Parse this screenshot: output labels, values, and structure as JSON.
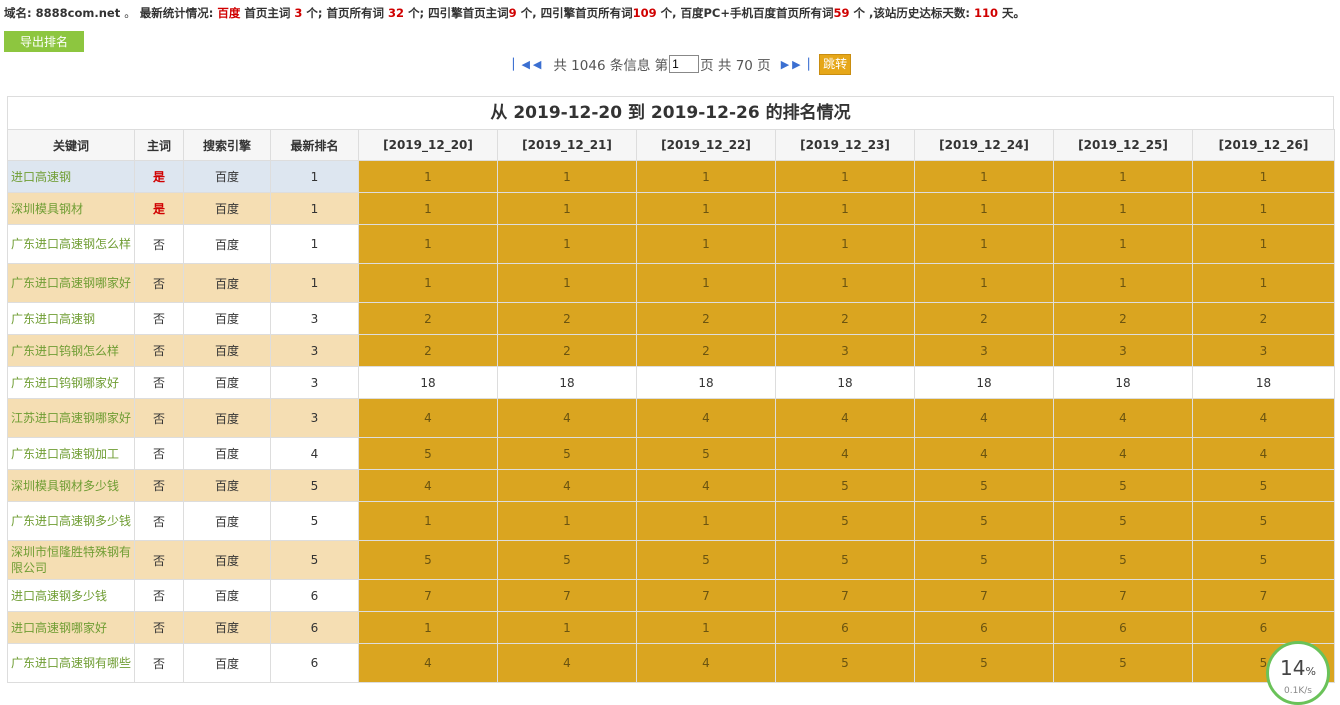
{
  "stats": {
    "label_domain": "域名:",
    "domain": "8888com.net",
    "sep1": "。",
    "label_latest": "最新统计情况:",
    "engine": "百度",
    "label_home_main": "首页主词",
    "home_main": "3",
    "unit1": "个; 首页所有词",
    "home_all": "32",
    "unit2": "个; 四引擎首页主词",
    "four_main": "9",
    "unit3": "个, 四引擎首页所有词",
    "four_all": "109",
    "unit4": "个, 百度PC+手机百度首页所有词",
    "pc_mobile": "59",
    "unit5": "个 ,该站历史达标天数:",
    "days": "110",
    "unit6": "天。"
  },
  "toolbar": {
    "export_label": "导出排名"
  },
  "pager": {
    "first_icon": "first-page-icon",
    "prev_icon": "prev-page-icon",
    "next_icon": "next-page-icon",
    "last_icon": "last-page-icon",
    "total_text": "共 1046 条信息 第",
    "page_value": "1",
    "pages_text": "页 共 70 页",
    "go_label": "跳转"
  },
  "table": {
    "caption": "从 2019-12-20 到 2019-12-26 的排名情况",
    "headers": [
      "关键词",
      "主词",
      "搜索引擎",
      "最新排名",
      "[2019_12_20]",
      "[2019_12_21]",
      "[2019_12_22]",
      "[2019_12_23]",
      "[2019_12_24]",
      "[2019_12_25]",
      "[2019_12_26]"
    ],
    "rows": [
      {
        "keyword": "进口高速钢",
        "main": "是",
        "engine": "百度",
        "latest": "1",
        "days": [
          "1",
          "1",
          "1",
          "1",
          "1",
          "1",
          "1"
        ]
      },
      {
        "keyword": "深圳模具钢材",
        "main": "是",
        "engine": "百度",
        "latest": "1",
        "days": [
          "1",
          "1",
          "1",
          "1",
          "1",
          "1",
          "1"
        ]
      },
      {
        "keyword": "广东进口高速钢怎么样",
        "main": "否",
        "engine": "百度",
        "latest": "1",
        "days": [
          "1",
          "1",
          "1",
          "1",
          "1",
          "1",
          "1"
        ]
      },
      {
        "keyword": "广东进口高速钢哪家好",
        "main": "否",
        "engine": "百度",
        "latest": "1",
        "days": [
          "1",
          "1",
          "1",
          "1",
          "1",
          "1",
          "1"
        ]
      },
      {
        "keyword": "广东进口高速钢",
        "main": "否",
        "engine": "百度",
        "latest": "3",
        "days": [
          "2",
          "2",
          "2",
          "2",
          "2",
          "2",
          "2"
        ]
      },
      {
        "keyword": "广东进口钨钢怎么样",
        "main": "否",
        "engine": "百度",
        "latest": "3",
        "days": [
          "2",
          "2",
          "2",
          "3",
          "3",
          "3",
          "3"
        ]
      },
      {
        "keyword": "广东进口钨钢哪家好",
        "main": "否",
        "engine": "百度",
        "latest": "3",
        "days": [
          "18",
          "18",
          "18",
          "18",
          "18",
          "18",
          "18"
        ]
      },
      {
        "keyword": "江苏进口高速钢哪家好",
        "main": "否",
        "engine": "百度",
        "latest": "3",
        "days": [
          "4",
          "4",
          "4",
          "4",
          "4",
          "4",
          "4"
        ]
      },
      {
        "keyword": "广东进口高速钢加工",
        "main": "否",
        "engine": "百度",
        "latest": "4",
        "days": [
          "5",
          "5",
          "5",
          "4",
          "4",
          "4",
          "4"
        ]
      },
      {
        "keyword": "深圳模具钢材多少钱",
        "main": "否",
        "engine": "百度",
        "latest": "5",
        "days": [
          "4",
          "4",
          "4",
          "5",
          "5",
          "5",
          "5"
        ]
      },
      {
        "keyword": "广东进口高速钢多少钱",
        "main": "否",
        "engine": "百度",
        "latest": "5",
        "days": [
          "1",
          "1",
          "1",
          "5",
          "5",
          "5",
          "5"
        ]
      },
      {
        "keyword": "深圳市恒隆胜特殊钢有限公司",
        "main": "否",
        "engine": "百度",
        "latest": "5",
        "days": [
          "5",
          "5",
          "5",
          "5",
          "5",
          "5",
          "5"
        ]
      },
      {
        "keyword": "进口高速钢多少钱",
        "main": "否",
        "engine": "百度",
        "latest": "6",
        "days": [
          "7",
          "7",
          "7",
          "7",
          "7",
          "7",
          "7"
        ]
      },
      {
        "keyword": "进口高速钢哪家好",
        "main": "否",
        "engine": "百度",
        "latest": "6",
        "days": [
          "1",
          "1",
          "1",
          "6",
          "6",
          "6",
          "6"
        ]
      },
      {
        "keyword": "广东进口高速钢有哪些",
        "main": "否",
        "engine": "百度",
        "latest": "6",
        "days": [
          "4",
          "4",
          "4",
          "5",
          "5",
          "5",
          "5"
        ]
      }
    ],
    "row_heights": [
      32,
      32,
      39,
      39,
      32,
      32,
      32,
      39,
      32,
      32,
      39,
      39,
      32,
      32,
      39
    ]
  },
  "badge": {
    "percent": "14",
    "percent_sign": "%",
    "sub": "0.1K/s"
  },
  "colors": {
    "gold": "#daa520",
    "wheat": "#f5deb3",
    "green": "#8dc63f",
    "red": "#d00000",
    "keyword": "#6f9d33"
  }
}
